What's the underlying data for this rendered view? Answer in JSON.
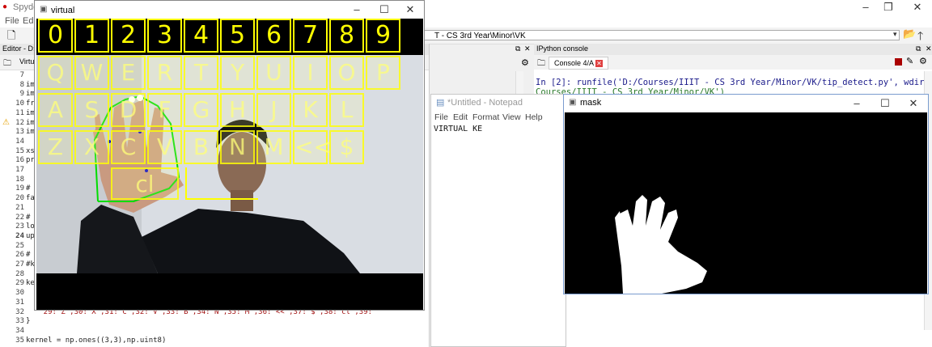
{
  "spyder": {
    "title": "Spyder",
    "menu": [
      "File",
      "Edit"
    ],
    "path": "T - CS 3rd Year\\Minor\\VK",
    "editor_title": "Editor - D:\\",
    "editor_tab": "Virtu",
    "line_numbers": [
      "7",
      "8",
      "9",
      "10",
      "11",
      "12",
      "13",
      "14",
      "15",
      "16",
      "17",
      "18",
      "19",
      "20",
      "21",
      "22",
      "23",
      "24",
      "25",
      "26",
      "27",
      "28",
      "29",
      "30",
      "31",
      "32",
      "33",
      "34",
      "35"
    ],
    "code_lines": [
      "",
      "imp",
      "imp",
      "fro",
      "imp",
      "imp",
      "imp",
      "",
      "xs=",
      "pre",
      "",
      "",
      "#",
      "fac",
      "",
      "#",
      "low",
      "upp",
      "",
      "#",
      "#ke",
      "",
      "key",
      "",
      "",
      "    29:\"Z\",30:\"X\",31:\"C\",32:\"V\",33:\"B\",34:\"N\",35:\"M\",36:\"<<\",37:\"$\",38:\"cl\",39:\"",
      "}",
      "",
      "kernel = np.ones((3,3),np.uint8)"
    ]
  },
  "ipython": {
    "header": "IPython console",
    "tab": "Console 4/A",
    "line1": "In [2]: runfile('D:/Courses/IIIT - CS 3rd Year/Minor/VK/tip_detect.py', wdir='D:/",
    "line2": "Courses/IIIT - CS 3rd Year/Minor/VK')"
  },
  "notepad": {
    "title": "*Untitled - Notepad",
    "menu": [
      "File",
      "Edit",
      "Format",
      "View",
      "Help"
    ],
    "text": "VIRTUAL KE"
  },
  "mask": {
    "title": "mask"
  },
  "virtual": {
    "title": "virtual",
    "rows": [
      [
        "0",
        "1",
        "2",
        "3",
        "4",
        "5",
        "6",
        "7",
        "8",
        "9"
      ],
      [
        "Q",
        "W",
        "E",
        "R",
        "T",
        "Y",
        "U",
        "I",
        "O",
        "P"
      ],
      [
        "A",
        "S",
        "D",
        "F",
        "G",
        "H",
        "J",
        "K",
        "L"
      ],
      [
        "Z",
        "X",
        "C",
        "V",
        "B",
        "N",
        "M",
        "<<",
        "$"
      ]
    ],
    "clear_key": "cl"
  },
  "colors": {
    "key_yellow": "#ffff00",
    "hand_outline": "#00dd00",
    "fingertip": "#0000cc"
  }
}
